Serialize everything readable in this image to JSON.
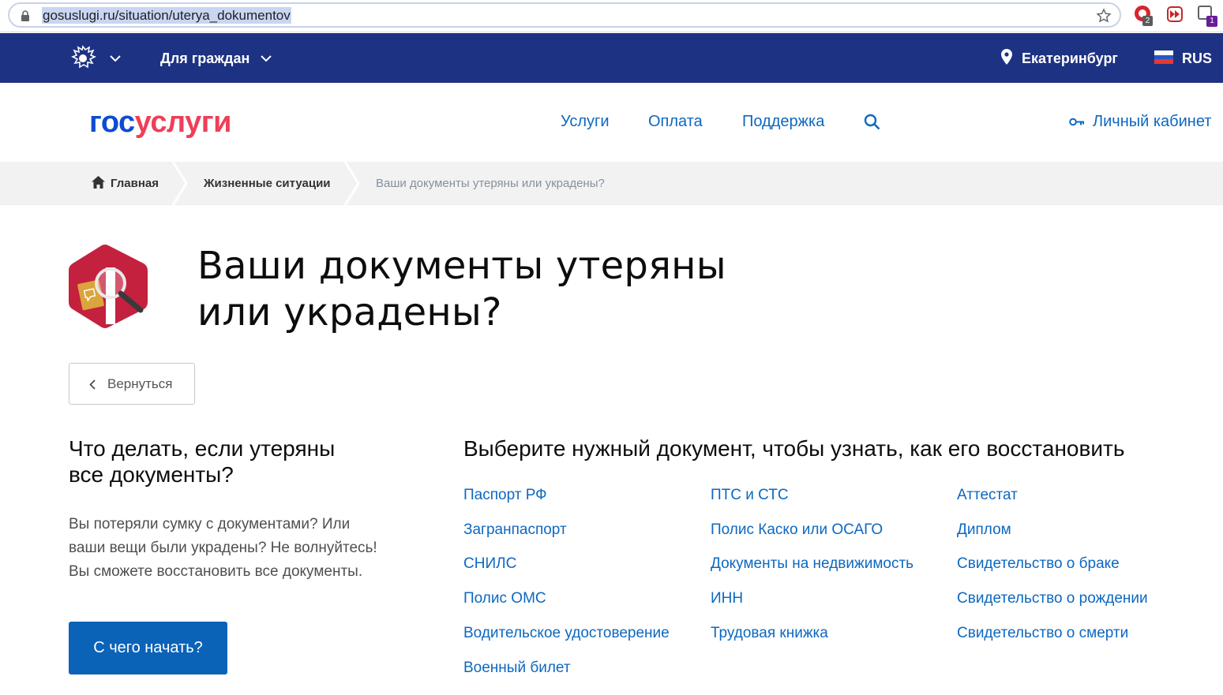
{
  "browser": {
    "url": "gosuslugi.ru/situation/uterya_dokumentov",
    "ext_badge_1": "2",
    "ext_badge_2": "1"
  },
  "topnav": {
    "citizens_label": "Для граждан",
    "city": "Екатеринбург",
    "language": "RUS"
  },
  "header": {
    "logo_part1": "гос",
    "logo_part2": "услуги",
    "nav": [
      "Услуги",
      "Оплата",
      "Поддержка"
    ],
    "account": "Личный кабинет"
  },
  "breadcrumb": {
    "home": "Главная",
    "section": "Жизненные ситуации",
    "current": "Ваши документы утеряны или украдены?"
  },
  "page": {
    "title_line1": "Ваши документы утеряны",
    "title_line2": "или украдены?",
    "back_label": "Вернуться"
  },
  "left": {
    "heading_line1": "Что делать, если утеряны",
    "heading_line2": "все документы?",
    "para_line1": "Вы потеряли сумку с документами? Или",
    "para_line2": "ваши вещи были украдены? Не волнуйтесь!",
    "para_line3": "Вы сможете восстановить все документы.",
    "start_button": "С чего начать?"
  },
  "right": {
    "heading": "Выберите нужный документ, чтобы узнать, как его восстановить",
    "columns": [
      [
        "Паспорт РФ",
        "Загранпаспорт",
        "СНИЛС",
        "Полис ОМС",
        "Водительское удостоверение",
        "Военный билет"
      ],
      [
        "ПТС и СТС",
        "Полис Каско или ОСАГО",
        "Документы на недвижимость",
        "ИНН",
        "Трудовая книжка"
      ],
      [
        "Аттестат",
        "Диплом",
        "Свидетельство о браке",
        "Свидетельство о рождении",
        "Свидетельство о смерти"
      ]
    ]
  },
  "colors": {
    "topnav_bg": "#1e3284",
    "link": "#0d68c0",
    "logo_blue": "#0d4cd3",
    "logo_red": "#ee3f58",
    "button": "#0b63b8"
  }
}
